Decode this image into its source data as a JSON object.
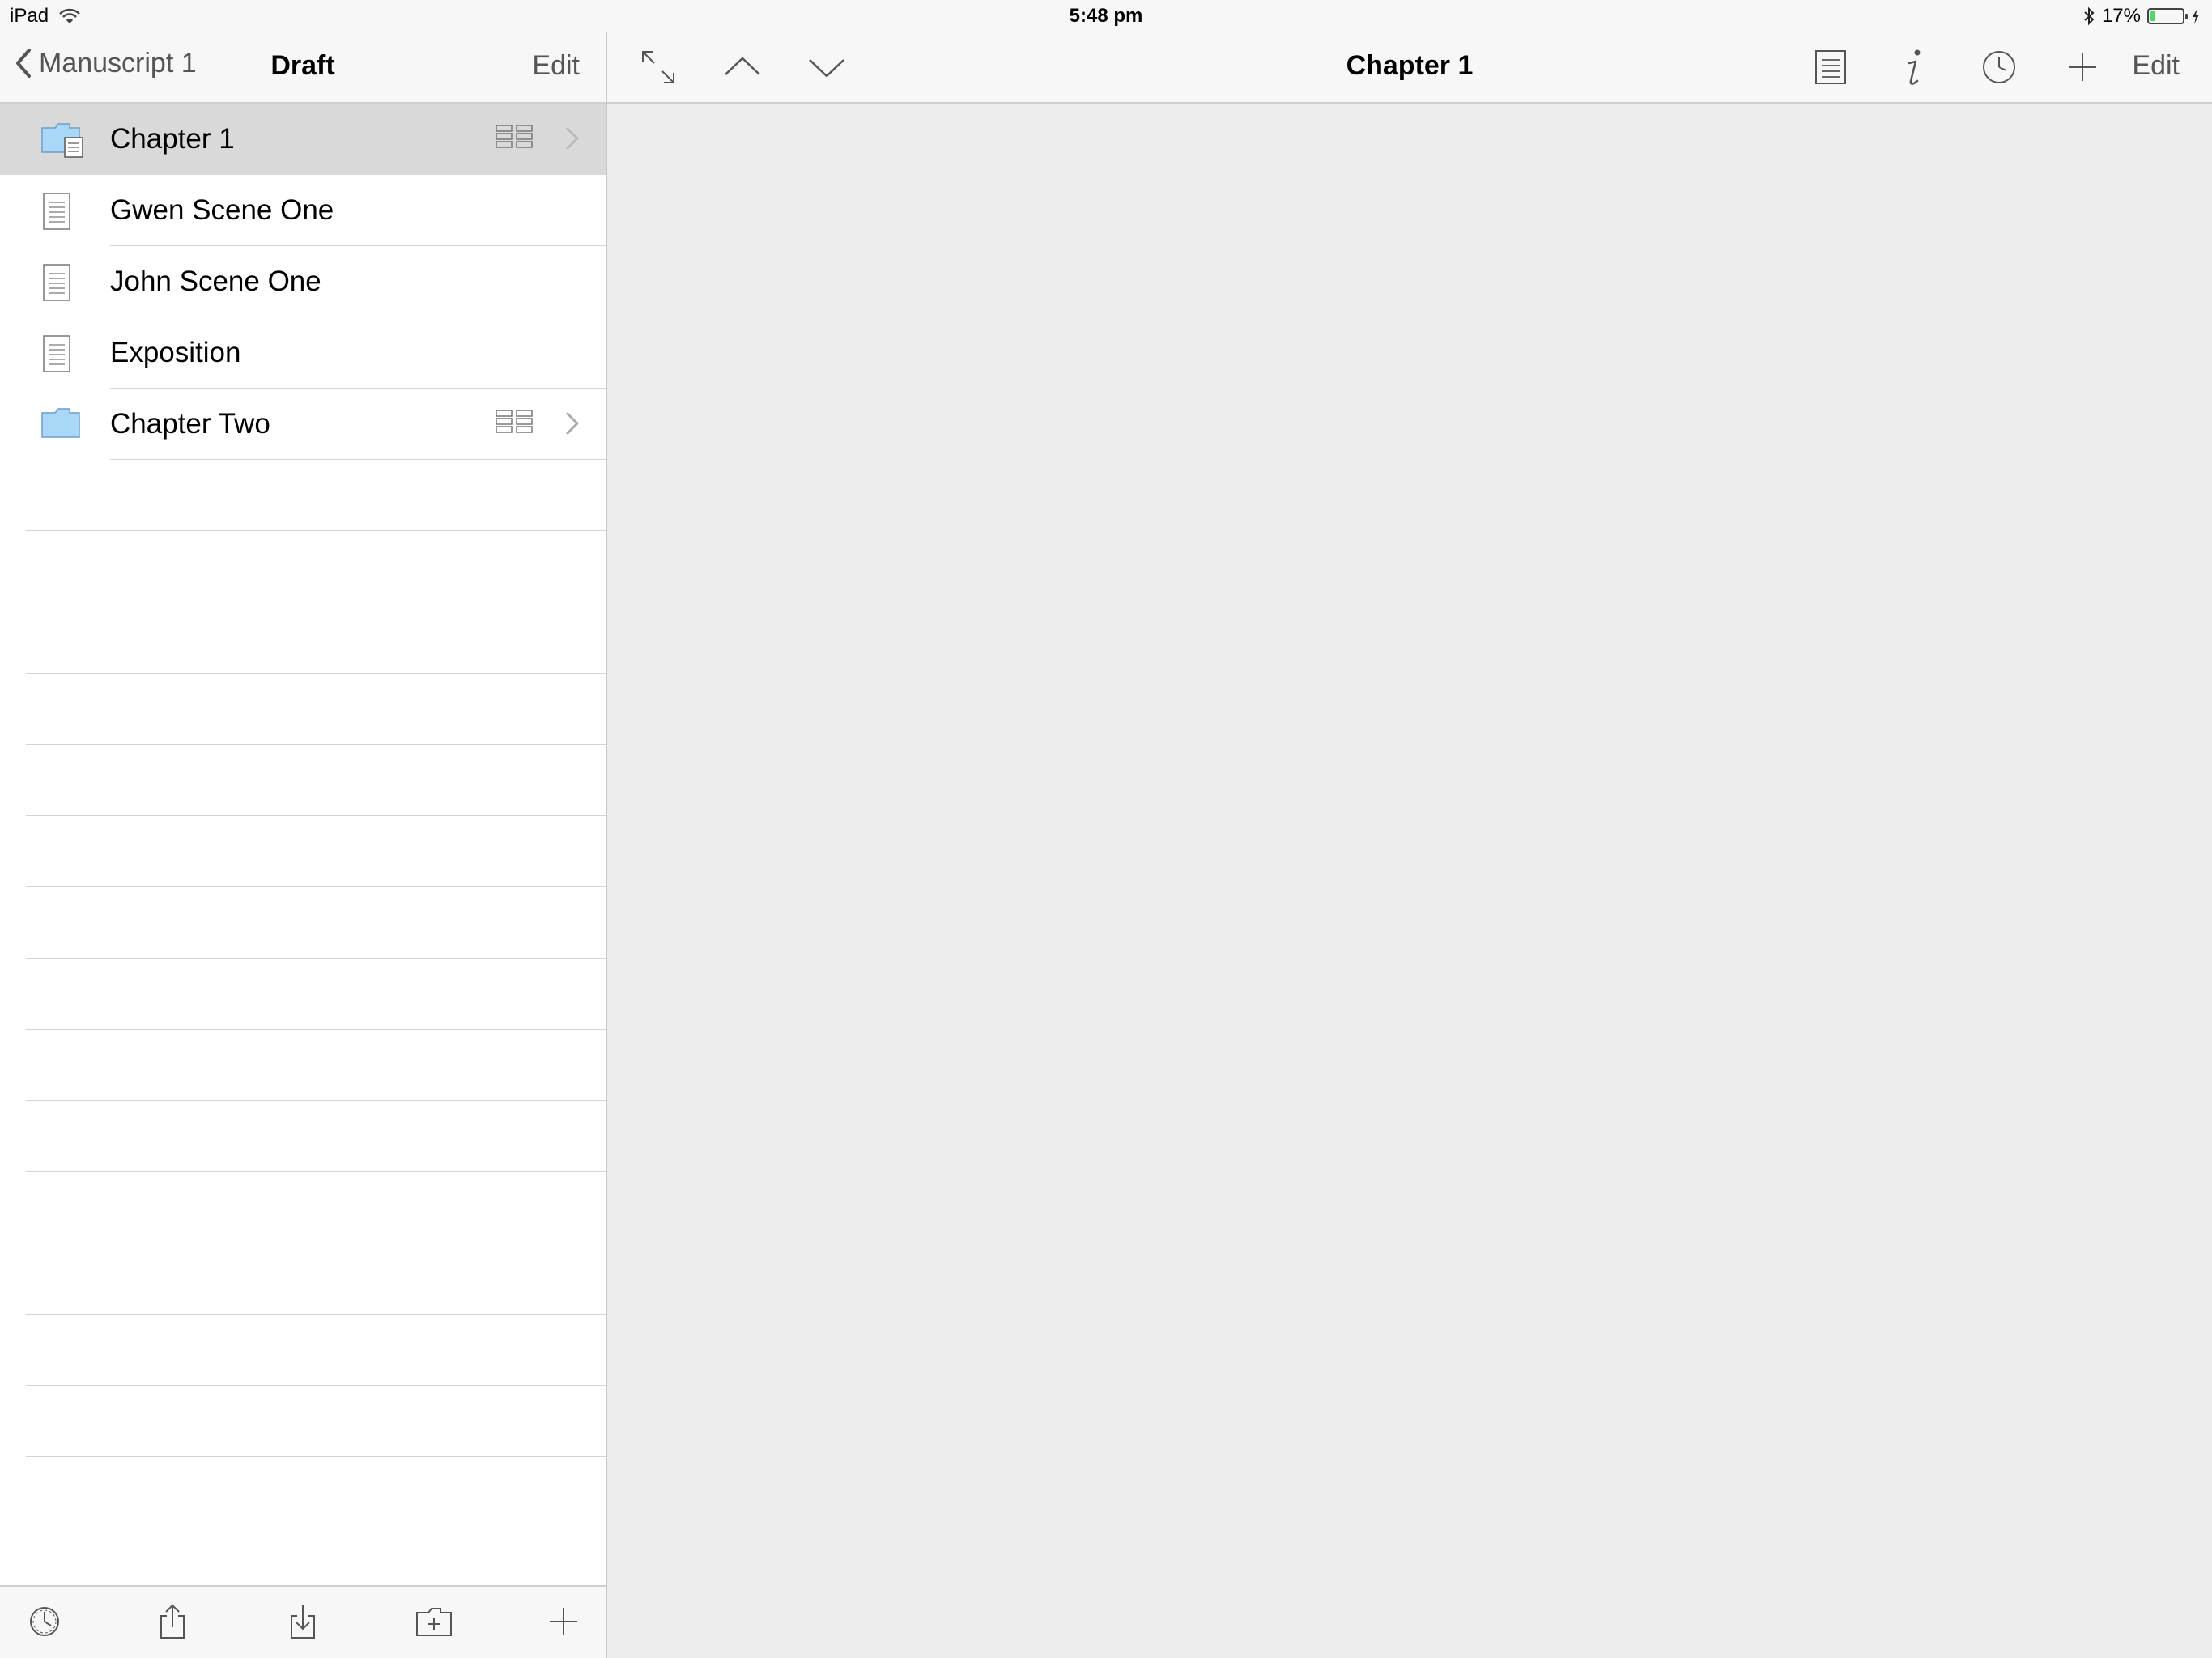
{
  "status_bar": {
    "device": "iPad",
    "time": "5:48 pm",
    "battery_percent": "17%",
    "battery_level": 0.17
  },
  "sidebar": {
    "back_label": "Manuscript 1",
    "title": "Draft",
    "edit_label": "Edit",
    "items": [
      {
        "label": "Chapter 1",
        "type": "folder-doc",
        "selected": true,
        "has_children": true
      },
      {
        "label": "Gwen Scene One",
        "type": "document"
      },
      {
        "label": "John Scene One",
        "type": "document"
      },
      {
        "label": "Exposition",
        "type": "document"
      },
      {
        "label": "Chapter Two",
        "type": "folder",
        "has_children": true
      }
    ],
    "toolbar_icons": [
      "settings-icon",
      "share-icon",
      "import-icon",
      "new-folder-icon",
      "add-icon"
    ]
  },
  "main": {
    "title": "Chapter 1",
    "edit_label": "Edit",
    "left_icons": [
      "expand-icon",
      "previous-icon",
      "next-icon"
    ],
    "right_icons": [
      "document-icon",
      "info-icon",
      "history-icon",
      "add-icon"
    ]
  },
  "colors": {
    "folder": "#a9d7f7",
    "selection": "#d9d9d9",
    "battery": "#4cd964",
    "bar": "#f7f7f7"
  }
}
